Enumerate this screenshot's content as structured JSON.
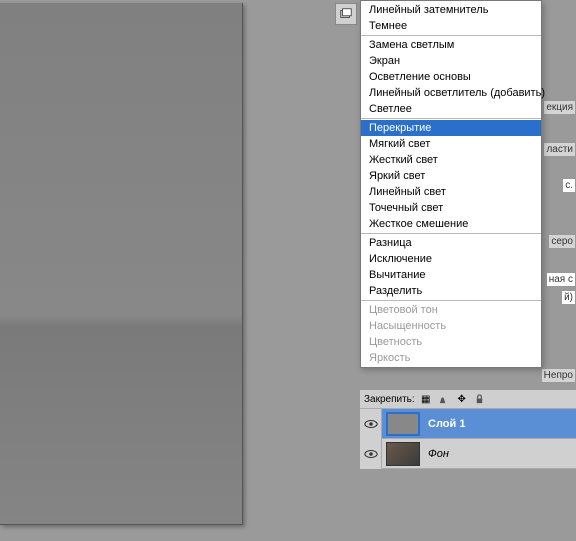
{
  "blend_modes": {
    "group0": [
      "Линейный затемнитель",
      "Темнее"
    ],
    "group1": [
      "Замена светлым",
      "Экран",
      "Осветление основы",
      "Линейный осветлитель (добавить)",
      "Светлее"
    ],
    "group2": [
      "Перекрытие",
      "Мягкий свет",
      "Жесткий свет",
      "Яркий свет",
      "Линейный свет",
      "Точечный свет",
      "Жесткое смешение"
    ],
    "group3": [
      "Разница",
      "Исключение",
      "Вычитание",
      "Разделить"
    ],
    "group4": [
      "Цветовой тон",
      "Насыщенность",
      "Цветность",
      "Яркость"
    ],
    "selected": "Перекрытие",
    "disabled": [
      "Цветовой тон",
      "Насыщенность",
      "Цветность",
      "Яркость"
    ]
  },
  "layers": {
    "lock_label": "Закрепить:",
    "items": [
      {
        "name": "Слой 1",
        "active": true
      },
      {
        "name": "Фон",
        "active": false,
        "italic": true
      }
    ]
  },
  "panel_fragments": {
    "f1": "екция",
    "f2": "ласти",
    "f3": "с.",
    "f4": "серо",
    "f5": "ная с",
    "f6": "й)",
    "f7": "Непро"
  }
}
